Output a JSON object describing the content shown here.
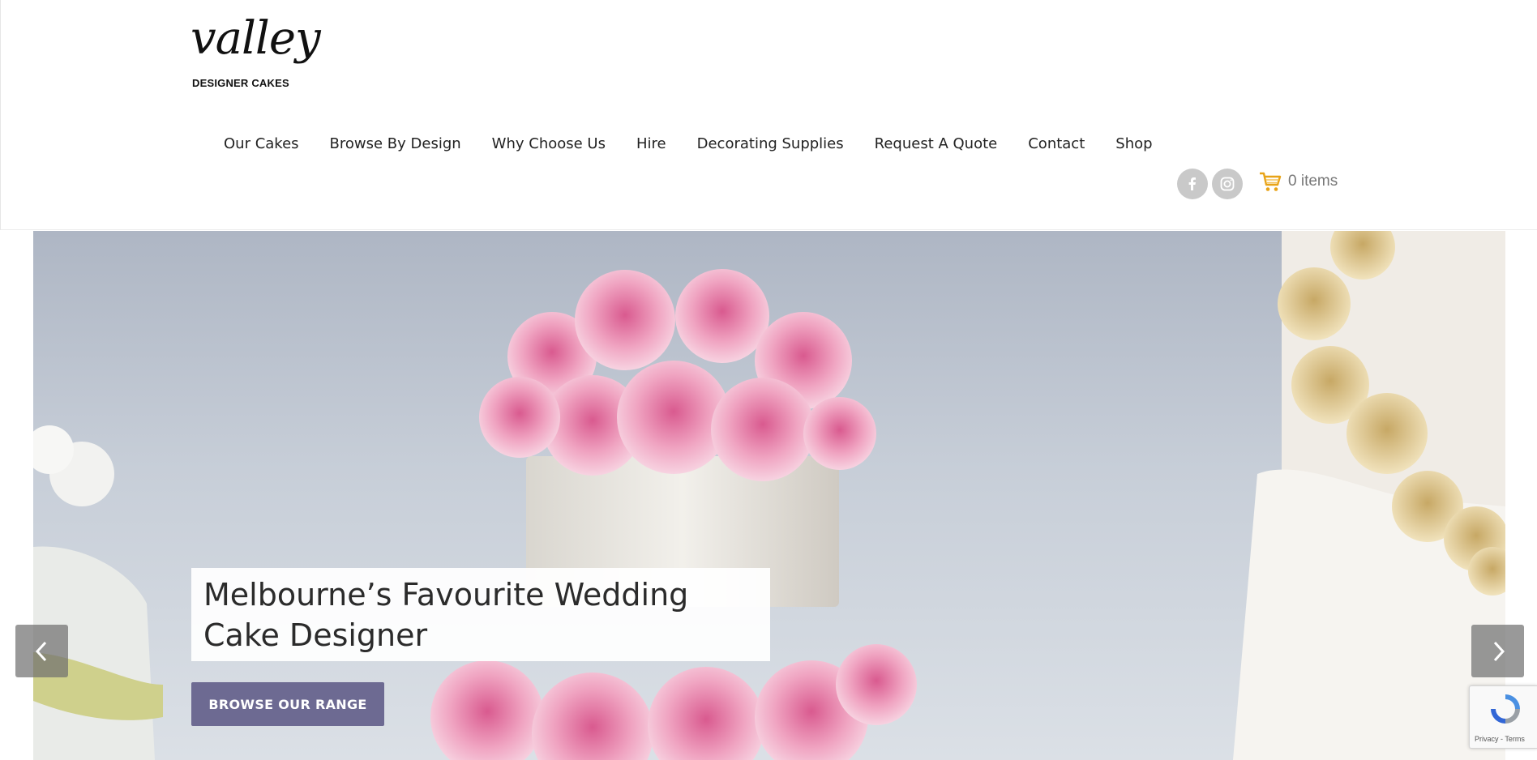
{
  "brand": {
    "logo_script": "valley",
    "logo_subtitle": "DESIGNER CAKES"
  },
  "nav": {
    "items": [
      {
        "label": "Our Cakes"
      },
      {
        "label": "Browse By Design"
      },
      {
        "label": "Why Choose Us"
      },
      {
        "label": "Hire"
      },
      {
        "label": "Decorating Supplies"
      },
      {
        "label": "Request A Quote"
      },
      {
        "label": "Contact"
      },
      {
        "label": "Shop"
      }
    ]
  },
  "social": {
    "icons": [
      "facebook-icon",
      "instagram-icon"
    ]
  },
  "cart": {
    "label": "0 items",
    "icon": "cart-icon",
    "icon_color": "#e8a317"
  },
  "hero": {
    "caption": "Melbourne’s Favourite Wedding Cake Designer",
    "button_label": "BROWSE OUR RANGE",
    "button_color": "#6d6a92",
    "prev_icon": "chevron-left-icon",
    "next_icon": "chevron-right-icon"
  },
  "recaptcha": {
    "terms": "Privacy - Terms"
  }
}
